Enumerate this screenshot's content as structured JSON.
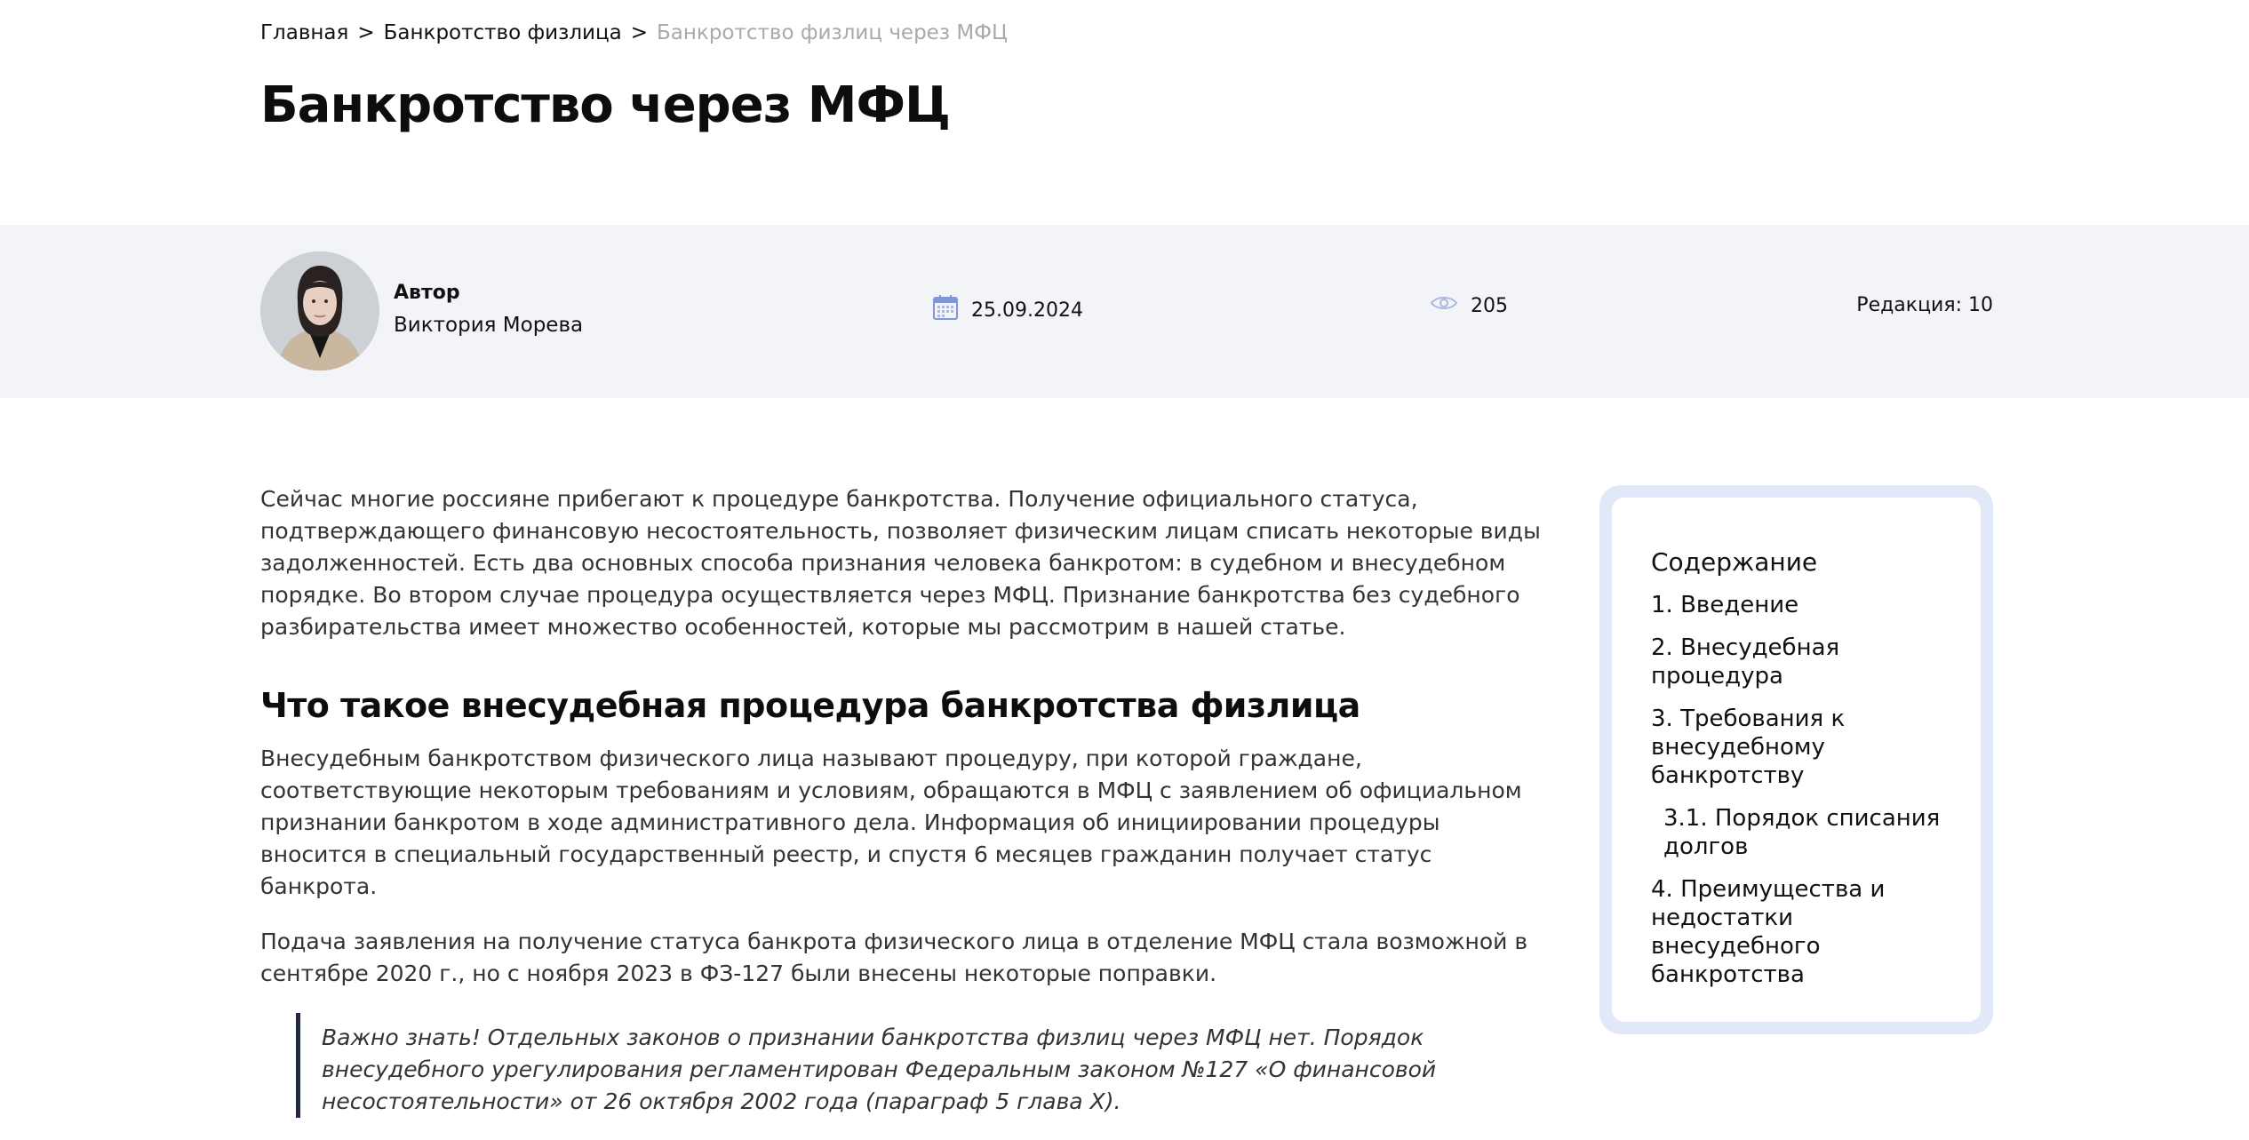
{
  "breadcrumb": {
    "home": "Главная",
    "section": "Банкротство физлица",
    "current": "Банкротство физлиц через МФЦ",
    "separator": ">"
  },
  "page_title": "Банкротство через МФЦ",
  "meta": {
    "author_label": "Автор",
    "author_name": "Виктория Морева",
    "date": "25.09.2024",
    "views": "205",
    "revision": "Редакция: 10",
    "icons": {
      "date": "calendar-icon",
      "views": "eye-icon"
    },
    "accent_color": "#7f97d6"
  },
  "article": {
    "intro": "Сейчас многие россияне прибегают к процедуре банкротства. Получение официального статуса, подтверждающего финансовую несостоятельность, позволяет физическим лицам списать некоторые виды задолженностей. Есть два основных способа признания человека банкротом: в судебном и внесудебном порядке. Во втором случае процедура осуществляется через МФЦ. Признание банкротства без судебного разбирательства имеет множество особенностей, которые мы рассмотрим в нашей статье.",
    "heading": "Что такое внесудебная процедура банкротства физлица",
    "paragraph1": "Внесудебным банкротством физического лица называют процедуру, при которой граждане, соответствующие некоторым требованиям и условиям, обращаются в МФЦ с заявлением об официальном признании банкротом в ходе административного дела. Информация об инициировании процедуры вносится в специальный государственный реестр, и спустя 6 месяцев гражданин получает статус банкрота.",
    "paragraph2": "Подача заявления на получение статуса банкрота физического лица в отделение МФЦ стала возможной в сентябре 2020 г., но с ноября 2023 в ФЗ-127 были внесены некоторые поправки.",
    "note": "Важно знать! Отдельных законов о признании банкротства физлиц через МФЦ нет. Порядок внесудебного урегулирования регламентирован Федеральным законом №127 «О финансовой несостоятельности» от 26 октября 2002 года (параграф 5 глава X)."
  },
  "toc": {
    "title": "Содержание",
    "items": [
      {
        "label": "1. Введение"
      },
      {
        "label": "2. Внесудебная процедура"
      },
      {
        "label": "3. Требования к внесудебному банкротству"
      },
      {
        "label": "3.1. Порядок списания долгов"
      },
      {
        "label": "4. Преимущества и недостатки внесудебного банкротства"
      }
    ]
  }
}
